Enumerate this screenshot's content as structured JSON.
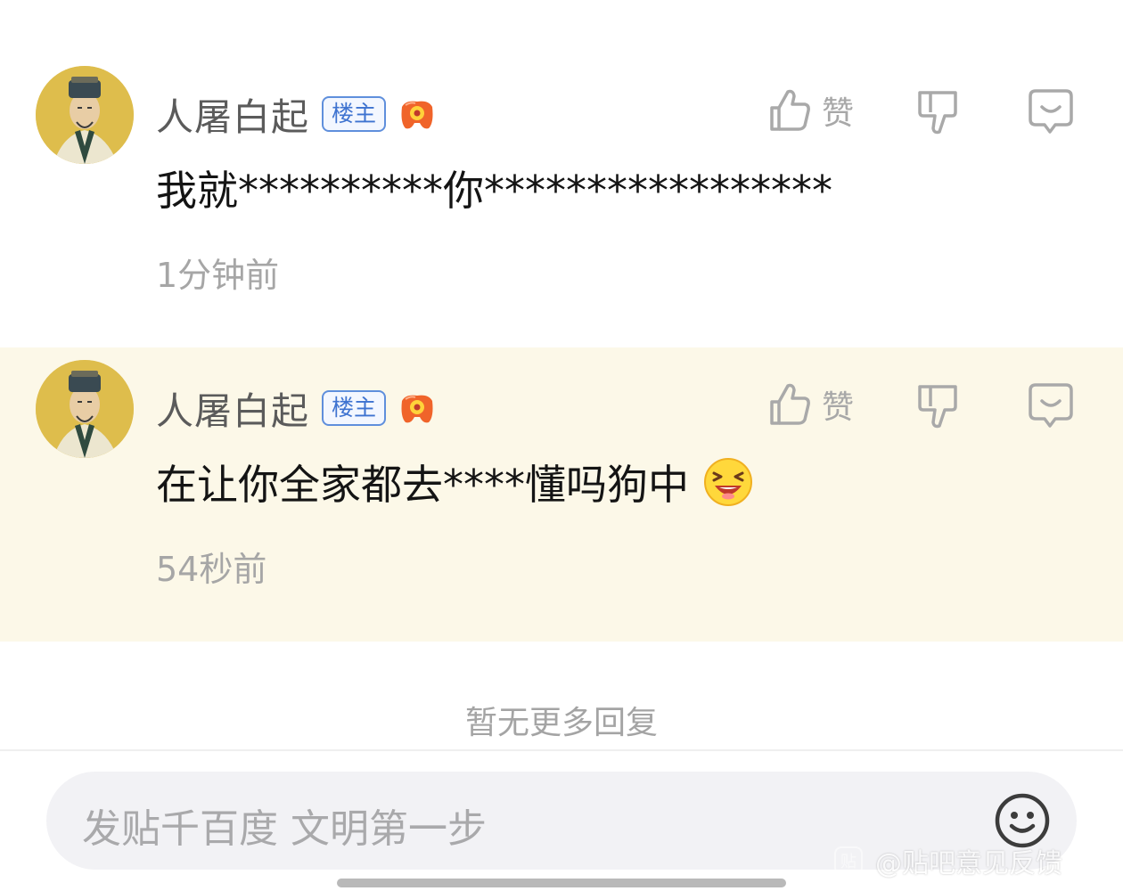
{
  "comments": [
    {
      "username": "人屠白起",
      "badge": "楼主",
      "like_label": "赞",
      "content": "我就**********你*****************",
      "time": "1分钟前"
    },
    {
      "username": "人屠白起",
      "badge": "楼主",
      "like_label": "赞",
      "content": "在让你全家都去****懂吗狗中",
      "time": "54秒前"
    }
  ],
  "footer": {
    "no_more": "暂无更多回复"
  },
  "input": {
    "placeholder": "发贴千百度 文明第一步"
  },
  "watermark": {
    "logo": "贴",
    "text": "@贴吧意见反馈"
  },
  "icons": {
    "like": "thumbs-up-icon",
    "dislike": "thumbs-down-icon",
    "reply": "reply-bubble-icon",
    "medal": "game-controller-medal-icon",
    "emoji": "smiley-icon",
    "laugh": "laughing-emoji-icon"
  },
  "colors": {
    "highlight_background": "#fcf8e8",
    "badge_blue": "#3e73d0",
    "icon_gray": "#a9a9a9",
    "medal_orange": "#f0642a"
  }
}
